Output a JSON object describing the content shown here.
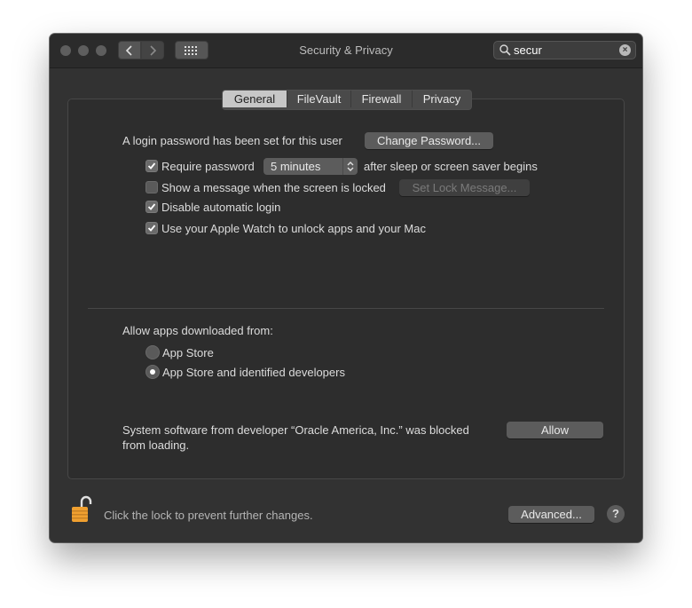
{
  "window": {
    "title": "Security & Privacy",
    "search_value": "secur"
  },
  "tabs": [
    {
      "label": "General",
      "active": true
    },
    {
      "label": "FileVault",
      "active": false
    },
    {
      "label": "Firewall",
      "active": false
    },
    {
      "label": "Privacy",
      "active": false
    }
  ],
  "general": {
    "login_text": "A login password has been set for this user",
    "change_password_label": "Change Password...",
    "require_password": {
      "label": "Require password",
      "checked": true,
      "popup_value": "5 minutes",
      "suffix": "after sleep or screen saver begins"
    },
    "show_message": {
      "label": "Show a message when the screen is locked",
      "checked": false,
      "button_label": "Set Lock Message..."
    },
    "disable_auto_login": {
      "label": "Disable automatic login",
      "checked": true
    },
    "apple_watch": {
      "label": "Use your Apple Watch to unlock apps and your Mac",
      "checked": true
    }
  },
  "downloads": {
    "heading": "Allow apps downloaded from:",
    "options": [
      {
        "label": "App Store",
        "selected": false
      },
      {
        "label": "App Store and identified developers",
        "selected": true
      }
    ]
  },
  "blocked": {
    "line1": "System software from developer “Oracle America, Inc.” was blocked",
    "line2": "from loading.",
    "allow_label": "Allow"
  },
  "footer": {
    "lock_text": "Click the lock to prevent further changes.",
    "advanced_label": "Advanced...",
    "help_label": "?"
  },
  "colors": {
    "window_bg": "#323232",
    "panel_bg": "#2d2d2d",
    "lock_orange": "#f0a030"
  }
}
